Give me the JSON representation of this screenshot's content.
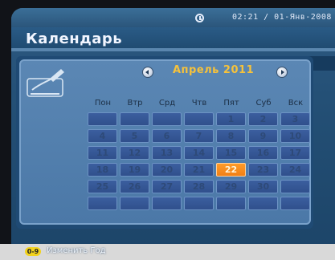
{
  "header": {
    "title": "Календарь",
    "datetime": "02:21 / 01-Янв-2008",
    "clock_icon": "clock-icon"
  },
  "calendar": {
    "month_label": "Апрель 2011",
    "weekdays": [
      "Пон",
      "Втр",
      "Срд",
      "Чтв",
      "Пят",
      "Суб",
      "Вск"
    ],
    "weeks": [
      [
        "",
        "",
        "",
        "",
        "1",
        "2",
        "3"
      ],
      [
        "4",
        "5",
        "6",
        "7",
        "8",
        "9",
        "10"
      ],
      [
        "11",
        "12",
        "13",
        "14",
        "15",
        "16",
        "17"
      ],
      [
        "18",
        "19",
        "20",
        "21",
        "22",
        "23",
        "24"
      ],
      [
        "25",
        "26",
        "27",
        "28",
        "29",
        "30",
        ""
      ],
      [
        "",
        "",
        "",
        "",
        "",
        "",
        ""
      ]
    ],
    "selected_day": "22",
    "accent_color": "#f58a19",
    "month_color": "#f6c23b"
  },
  "footer": {
    "key_label": "0-9",
    "action_label": "Изменить Год"
  }
}
